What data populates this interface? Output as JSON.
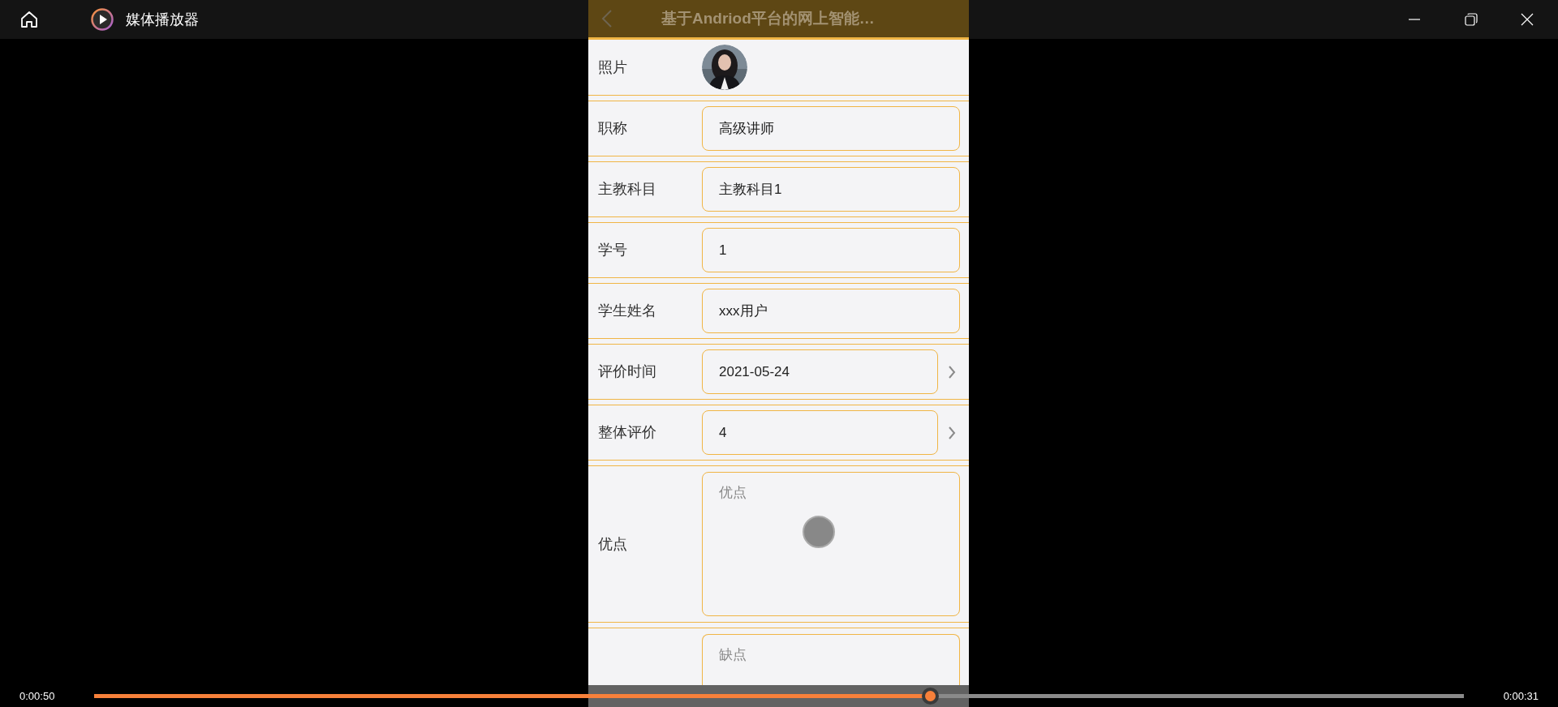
{
  "window": {
    "title": "媒体播放器"
  },
  "phone_header": {
    "title": "基于Andriod平台的网上智能…"
  },
  "form": {
    "rows": [
      {
        "label": "照片"
      },
      {
        "kind": "text",
        "label": "职称",
        "value": "高级讲师"
      },
      {
        "kind": "text",
        "label": "主教科目",
        "value": "主教科目1"
      },
      {
        "kind": "text",
        "label": "学号",
        "value": "1"
      },
      {
        "kind": "text",
        "label": "学生姓名",
        "value": "xxx用户"
      },
      {
        "kind": "select",
        "label": "评价时间",
        "value": "2021-05-24"
      },
      {
        "kind": "select",
        "label": "整体评价",
        "value": "4"
      },
      {
        "kind": "textarea",
        "label": "优点",
        "placeholder": "优点"
      },
      {
        "kind": "textarea",
        "placeholder": "缺点"
      }
    ]
  },
  "player": {
    "elapsed": "0:00:50",
    "remaining": "0:00:31",
    "level": 0.61
  }
}
